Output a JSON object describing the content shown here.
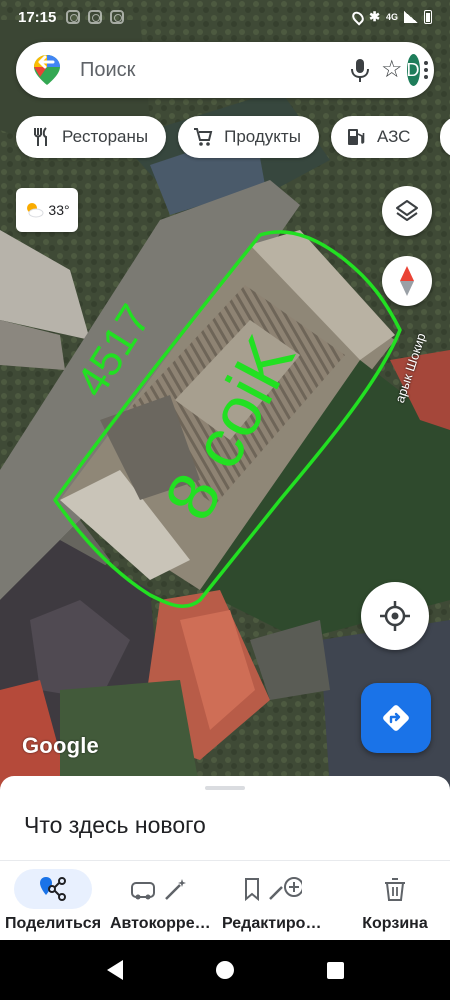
{
  "status_bar": {
    "time": "17:15",
    "network": "4G"
  },
  "search": {
    "placeholder": "Поиск",
    "avatar_letter": "D"
  },
  "chips": [
    {
      "label": "Рестораны",
      "icon": "restaurant-icon"
    },
    {
      "label": "Продукты",
      "icon": "cart-icon"
    },
    {
      "label": "АЗС",
      "icon": "gas-station-icon"
    }
  ],
  "weather": {
    "temperature": "33°",
    "icon": "partly-sunny-icon"
  },
  "map": {
    "street_label": "арык Шокир",
    "annotation_number": "4517",
    "annotation_text": "8 coiK",
    "attribution": "Google",
    "annotation_color": "#22e022"
  },
  "sheet": {
    "title": "Что здесь нового"
  },
  "actions": [
    {
      "label": "Поделиться",
      "icon": "share-icon",
      "selected": true
    },
    {
      "label": "Автокорре…",
      "icon": "auto-correct-icon"
    },
    {
      "label": "Редактиро…",
      "icon": "edit-icon"
    },
    {
      "label": "Корзина",
      "icon": "trash-icon"
    }
  ],
  "colors": {
    "accent": "#1a73e8",
    "avatar": "#1e7d5a",
    "compass_red": "#ea4335"
  }
}
